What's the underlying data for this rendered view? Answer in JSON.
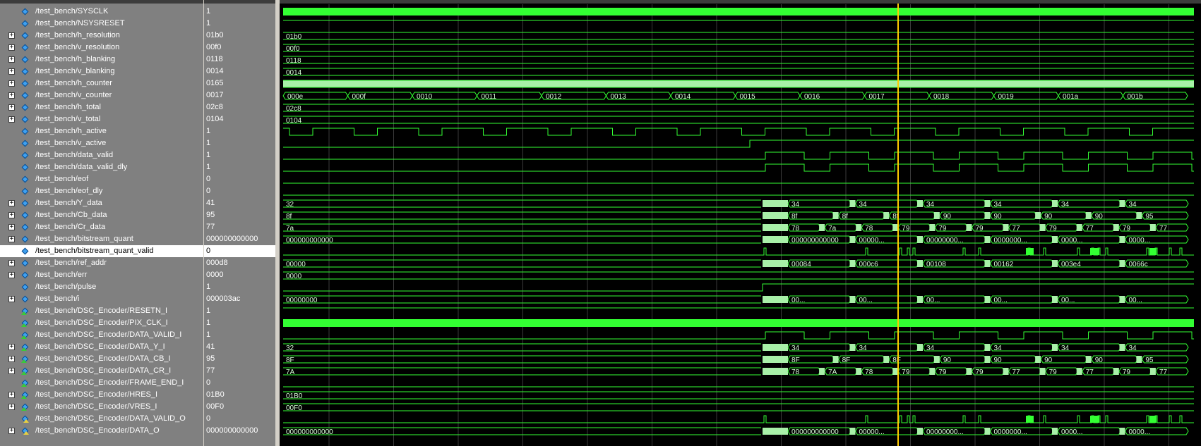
{
  "colors": {
    "wave": "#33ff33",
    "bus_fill": "#a8f0a8",
    "grid": "#3a3a3a",
    "cursor": "#ffcc00",
    "pane_bg": "#808080"
  },
  "signals": [
    {
      "name": "/test_bench/SYSCLK",
      "value": "1",
      "kind": "clk",
      "expand": false,
      "icon": "signal-icon"
    },
    {
      "name": "/test_bench/NSYSRESET",
      "value": "1",
      "kind": "high",
      "expand": false,
      "icon": "signal-icon"
    },
    {
      "name": "/test_bench/h_resolution",
      "value": "01b0",
      "kind": "bus",
      "expand": true,
      "icon": "signal-icon",
      "bus": [
        [
          "01b0",
          0
        ]
      ]
    },
    {
      "name": "/test_bench/v_resolution",
      "value": "00f0",
      "kind": "bus",
      "expand": true,
      "icon": "signal-icon",
      "bus": [
        [
          "00f0",
          0
        ]
      ]
    },
    {
      "name": "/test_bench/h_blanking",
      "value": "0118",
      "kind": "bus",
      "expand": true,
      "icon": "signal-icon",
      "bus": [
        [
          "0118",
          0
        ]
      ]
    },
    {
      "name": "/test_bench/v_blanking",
      "value": "0014",
      "kind": "bus",
      "expand": true,
      "icon": "signal-icon",
      "bus": [
        [
          "0014",
          0
        ]
      ]
    },
    {
      "name": "/test_bench/h_counter",
      "value": "0165",
      "kind": "fastbus",
      "expand": true,
      "icon": "signal-icon"
    },
    {
      "name": "/test_bench/v_counter",
      "value": "0017",
      "kind": "bus",
      "expand": true,
      "icon": "signal-icon",
      "bus": [
        [
          "000e",
          0
        ],
        [
          "000f",
          92
        ],
        [
          "0010",
          183
        ],
        [
          "0011",
          275
        ],
        [
          "0012",
          366
        ],
        [
          "0013",
          458
        ],
        [
          "0014",
          549
        ],
        [
          "0015",
          641
        ],
        [
          "0016",
          732
        ],
        [
          "0017",
          824
        ],
        [
          "0018",
          915
        ],
        [
          "0019",
          1007
        ],
        [
          "001a",
          1098
        ],
        [
          "001b",
          1190
        ]
      ]
    },
    {
      "name": "/test_bench/h_total",
      "value": "02c8",
      "kind": "bus",
      "expand": true,
      "icon": "signal-icon",
      "bus": [
        [
          "02c8",
          0
        ]
      ]
    },
    {
      "name": "/test_bench/v_total",
      "value": "0104",
      "kind": "bus",
      "expand": true,
      "icon": "signal-icon",
      "bus": [
        [
          "0104",
          0
        ]
      ]
    },
    {
      "name": "/test_bench/h_active",
      "value": "1",
      "kind": "hactive",
      "expand": false,
      "icon": "signal-icon"
    },
    {
      "name": "/test_bench/v_active",
      "value": "1",
      "kind": "vactive",
      "expand": false,
      "icon": "signal-icon"
    },
    {
      "name": "/test_bench/data_valid",
      "value": "1",
      "kind": "dvalid",
      "expand": false,
      "icon": "signal-icon"
    },
    {
      "name": "/test_bench/data_valid_dly",
      "value": "1",
      "kind": "dvalid",
      "expand": false,
      "icon": "signal-icon"
    },
    {
      "name": "/test_bench/eof",
      "value": "0",
      "kind": "low",
      "expand": false,
      "icon": "signal-icon"
    },
    {
      "name": "/test_bench/eof_dly",
      "value": "0",
      "kind": "low",
      "expand": false,
      "icon": "signal-icon"
    },
    {
      "name": "/test_bench/Y_data",
      "value": "41",
      "kind": "busy",
      "expand": true,
      "icon": "signal-icon",
      "first": "32",
      "labels": [
        "34",
        "34",
        "34",
        "34",
        "34",
        "34"
      ]
    },
    {
      "name": "/test_bench/Cb_data",
      "value": "95",
      "kind": "busy",
      "expand": true,
      "icon": "signal-icon",
      "first": "8f",
      "labels": [
        "8f",
        "8f",
        "8f",
        "90",
        "90",
        "90",
        "90",
        "95"
      ]
    },
    {
      "name": "/test_bench/Cr_data",
      "value": "77",
      "kind": "busy",
      "expand": true,
      "icon": "signal-icon",
      "first": "7a",
      "labels": [
        "78",
        "7a",
        "78",
        "79",
        "79",
        "79",
        "77",
        "79",
        "77",
        "79",
        "77"
      ]
    },
    {
      "name": "/test_bench/bitstream_quant",
      "value": "000000000000",
      "kind": "busy",
      "expand": true,
      "icon": "signal-icon",
      "first": "000000000000",
      "labels": [
        "000000000000",
        "00000...",
        "00000000...",
        "0000000...",
        "0000...",
        "0000..."
      ]
    },
    {
      "name": "/test_bench/bitstream_quant_valid",
      "value": "0",
      "kind": "pulses",
      "expand": false,
      "icon": "signal-icon",
      "selected": true
    },
    {
      "name": "/test_bench/ref_addr",
      "value": "000d8",
      "kind": "busy",
      "expand": true,
      "icon": "signal-icon",
      "first": "00000",
      "labels": [
        "00084",
        "000c6",
        "00108",
        "00162",
        "003e4",
        "0066c"
      ]
    },
    {
      "name": "/test_bench/err",
      "value": "0000",
      "kind": "bus",
      "expand": true,
      "icon": "signal-icon",
      "bus": [
        [
          "0000",
          0
        ]
      ]
    },
    {
      "name": "/test_bench/pulse",
      "value": "1",
      "kind": "pulse",
      "expand": false,
      "icon": "signal-icon"
    },
    {
      "name": "/test_bench/i",
      "value": "000003ac",
      "kind": "busy",
      "expand": true,
      "icon": "signal-icon",
      "first": "00000000",
      "labels": [
        "00...",
        "00...",
        "00...",
        "00...",
        "00...",
        "00..."
      ]
    },
    {
      "name": "/test_bench/DSC_Encoder/RESETN_I",
      "value": "1",
      "kind": "high",
      "expand": false,
      "icon": "input-icon"
    },
    {
      "name": "/test_bench/DSC_Encoder/PIX_CLK_I",
      "value": "1",
      "kind": "clk",
      "expand": false,
      "icon": "input-icon"
    },
    {
      "name": "/test_bench/DSC_Encoder/DATA_VALID_I",
      "value": "1",
      "kind": "dvalid",
      "expand": false,
      "icon": "input-icon"
    },
    {
      "name": "/test_bench/DSC_Encoder/DATA_Y_I",
      "value": "41",
      "kind": "busy",
      "expand": true,
      "icon": "input-icon",
      "first": "32",
      "labels": [
        "34",
        "34",
        "34",
        "34",
        "34",
        "34"
      ]
    },
    {
      "name": "/test_bench/DSC_Encoder/DATA_CB_I",
      "value": "95",
      "kind": "busy",
      "expand": true,
      "icon": "input-icon",
      "first": "8F",
      "labels": [
        "8F",
        "8F",
        "8F",
        "90",
        "90",
        "90",
        "90",
        "95"
      ]
    },
    {
      "name": "/test_bench/DSC_Encoder/DATA_CR_I",
      "value": "77",
      "kind": "busy",
      "expand": true,
      "icon": "input-icon",
      "first": "7A",
      "labels": [
        "78",
        "7A",
        "78",
        "79",
        "79",
        "79",
        "77",
        "79",
        "77",
        "79",
        "77"
      ]
    },
    {
      "name": "/test_bench/DSC_Encoder/FRAME_END_I",
      "value": "0",
      "kind": "low",
      "expand": false,
      "icon": "input-icon"
    },
    {
      "name": "/test_bench/DSC_Encoder/HRES_I",
      "value": "01B0",
      "kind": "bus",
      "expand": true,
      "icon": "input-icon",
      "bus": [
        [
          "01B0",
          0
        ]
      ]
    },
    {
      "name": "/test_bench/DSC_Encoder/VRES_I",
      "value": "00F0",
      "kind": "bus",
      "expand": true,
      "icon": "input-icon",
      "bus": [
        [
          "00F0",
          0
        ]
      ]
    },
    {
      "name": "/test_bench/DSC_Encoder/DATA_VALID_O",
      "value": "0",
      "kind": "pulses",
      "expand": false,
      "icon": "output-icon"
    },
    {
      "name": "/test_bench/DSC_Encoder/DATA_O",
      "value": "000000000000",
      "kind": "busy",
      "expand": true,
      "icon": "output-icon",
      "first": "000000000000",
      "labels": [
        "000000000000",
        "00000...",
        "00000000...",
        "0000000...",
        "0000...",
        "0000..."
      ]
    }
  ]
}
